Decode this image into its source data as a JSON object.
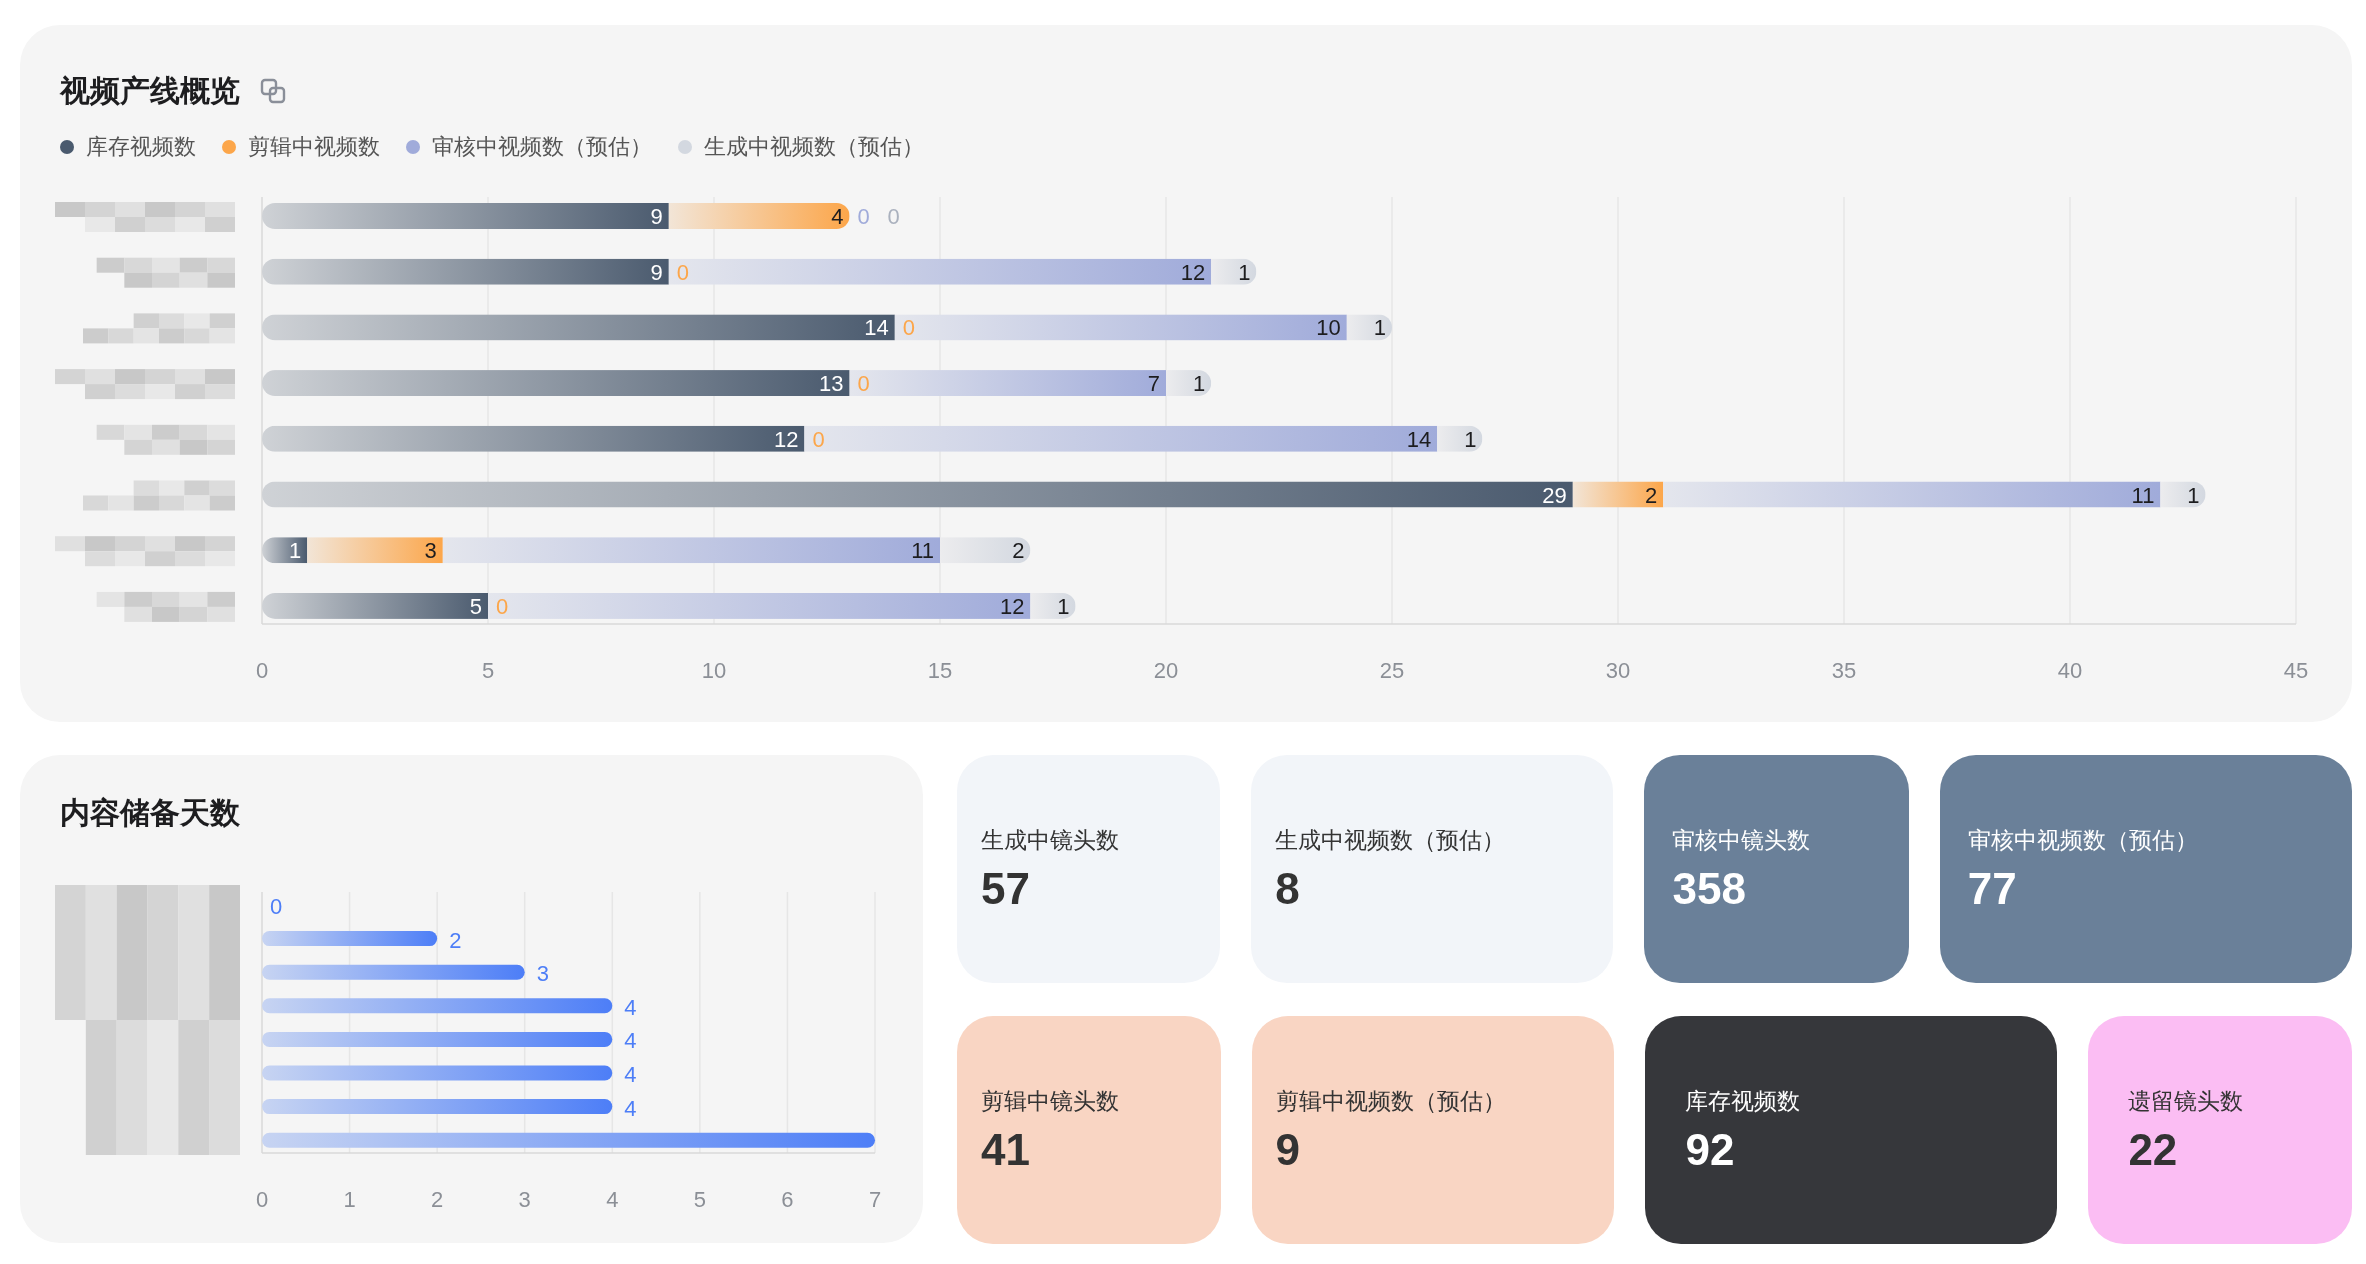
{
  "overview": {
    "title": "视频产线概览",
    "chart_data": {
      "type": "bar",
      "orientation": "horizontal",
      "stacked": true,
      "grid": true,
      "xlim": [
        0,
        45
      ],
      "value_labels": [
        [
          "9",
          "9",
          "14",
          "13",
          "12",
          "29",
          "1",
          "5"
        ],
        [
          "4",
          "0",
          "0",
          "0",
          "0",
          "2",
          "3",
          "0"
        ],
        [
          "0",
          "12",
          "10",
          "7",
          "14",
          "11",
          "11",
          "12"
        ],
        [
          "0",
          "1",
          "1",
          "1",
          "1",
          "1",
          "2",
          "1"
        ]
      ],
      "xticks": [
        0,
        5,
        10,
        15,
        20,
        25,
        30,
        35,
        40,
        45
      ],
      "series": [
        {
          "name": "库存视频数",
          "color": "#4a5a6e",
          "values": [
            9,
            9,
            14,
            13,
            12,
            29,
            1,
            5
          ]
        },
        {
          "name": "剪辑中视频数",
          "color": "#fca64a",
          "values": [
            4,
            0,
            0,
            0,
            0,
            2,
            3,
            0
          ]
        },
        {
          "name": "审核中视频数（预估）",
          "color": "#a0abda",
          "values": [
            0,
            12,
            10,
            7,
            14,
            11,
            11,
            12
          ]
        },
        {
          "name": "生成中视频数（预估）",
          "color": "#d3d8e0",
          "values": [
            0,
            1,
            1,
            1,
            1,
            1,
            2,
            1
          ]
        }
      ]
    }
  },
  "reserve": {
    "title": "内容储备天数",
    "chart_data": {
      "type": "bar",
      "orientation": "horizontal",
      "grid": true,
      "xlim": [
        0,
        7
      ],
      "xticks": [
        0,
        1,
        2,
        3,
        4,
        5,
        6,
        7
      ],
      "values": [
        0,
        2,
        3,
        4,
        4,
        4,
        4,
        7
      ],
      "value_labels": [
        "0",
        "2",
        "3",
        "4",
        "4",
        "4",
        "4",
        null
      ]
    }
  },
  "stat_rows": [
    [
      {
        "label": "生成中镜头数",
        "value": "57",
        "color": "#f2f5f9"
      },
      {
        "label": "生成中视频数（预估）",
        "value": "8",
        "color": "#f2f5f9"
      },
      {
        "label": "审核中镜头数",
        "value": "358",
        "color": "#6a8099"
      },
      {
        "label": "审核中视频数（预估）",
        "value": "77",
        "color": "#6a8099"
      }
    ],
    [
      {
        "label": "剪辑中镜头数",
        "value": "41",
        "color": "#f9d5c3"
      },
      {
        "label": "剪辑中视频数（预估）",
        "value": "9",
        "color": "#f9d5c3"
      },
      {
        "label": "库存视频数",
        "value": "92",
        "color": "#36373b"
      },
      {
        "label": "遗留镜头数",
        "value": "22",
        "color": "#fbbdf3"
      }
    ]
  ]
}
